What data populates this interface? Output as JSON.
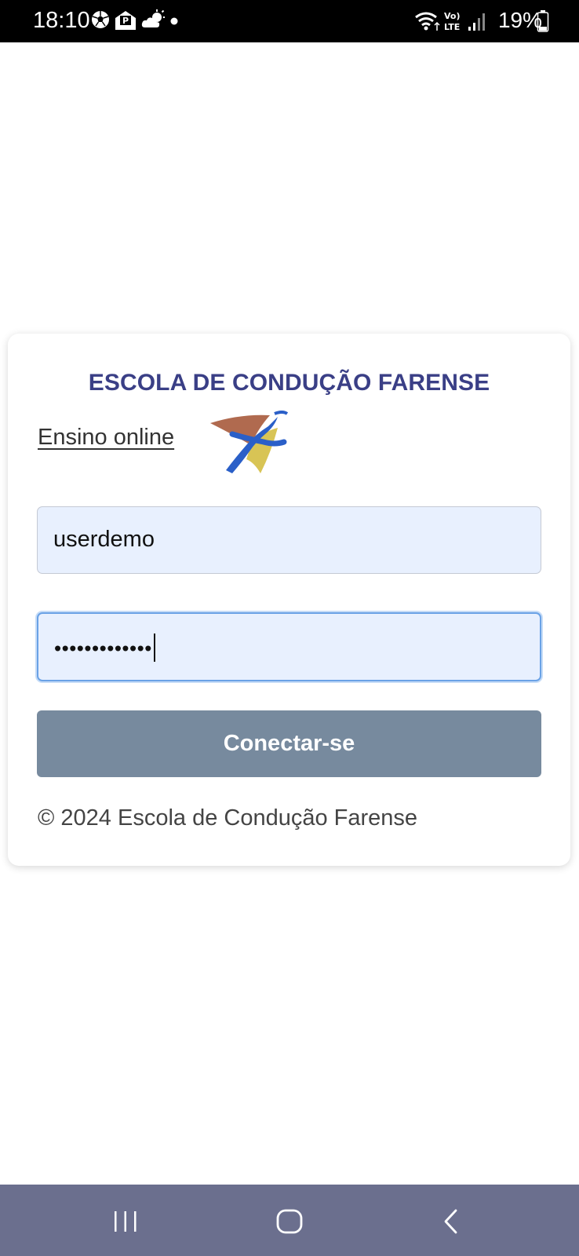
{
  "status_bar": {
    "time": "18:10",
    "battery": "19%",
    "icons": [
      "soccer-ball-icon",
      "mail-p-icon",
      "weather-cloud-sun-icon",
      "notification-dot-icon",
      "wifi-icon",
      "volte-lte-icon",
      "signal-bars-icon",
      "battery-icon"
    ]
  },
  "login": {
    "title": "ESCOLA DE CONDUÇÃO FARENSE",
    "subtitle_link": "Ensino online",
    "username_value": "userdemo",
    "password_mask": "•••••••••••••",
    "connect_label": "Conectar-se",
    "copyright": "© 2024 Escola de Condução Farense"
  },
  "logo": {
    "colors": {
      "brown": "#b06a4f",
      "yellow": "#d8c455",
      "blue": "#2a5fc8"
    }
  },
  "nav_bar": {
    "buttons": [
      "recent-apps-icon",
      "home-icon",
      "back-icon"
    ],
    "color": "#6b6f8e"
  }
}
